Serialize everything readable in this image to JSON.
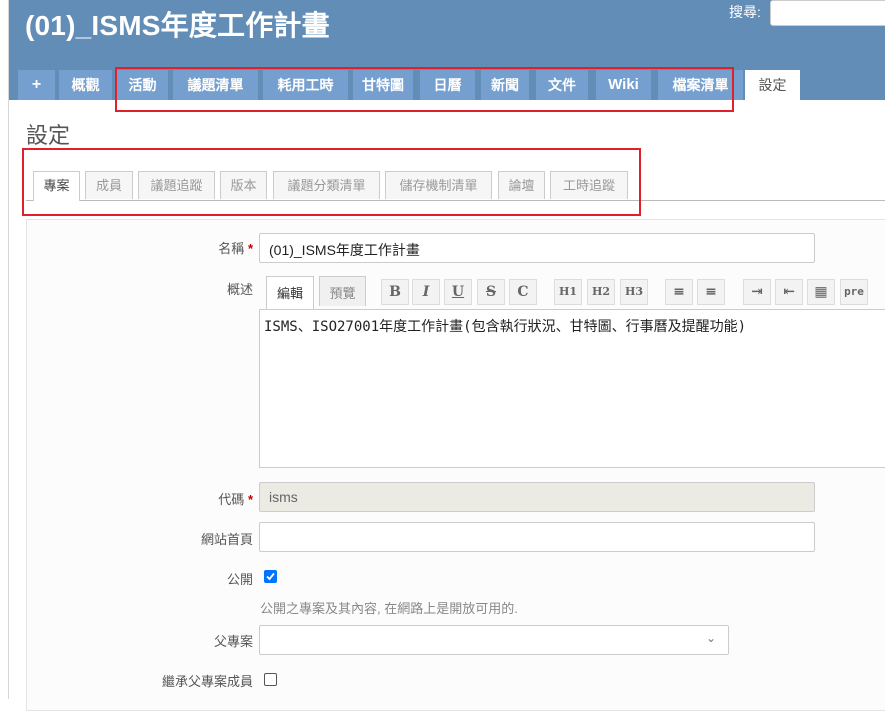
{
  "header": {
    "title": "(01)_ISMS年度工作計畫",
    "search_label": "搜尋:"
  },
  "menu": {
    "plus": "+",
    "items": [
      "概觀",
      "活動",
      "議題清單",
      "耗用工時",
      "甘特圖",
      "日曆",
      "新聞",
      "文件",
      "Wiki",
      "檔案清單",
      "設定"
    ]
  },
  "page_title": "設定",
  "subtabs": [
    "專案",
    "成員",
    "議題追蹤",
    "版本",
    "議題分類清單",
    "儲存機制清單",
    "論壇",
    "工時追蹤"
  ],
  "form": {
    "name_label": "名稱",
    "name_value": "(01)_ISMS年度工作計畫",
    "required_mark": "*",
    "desc_label": "概述",
    "edit_tab": "編輯",
    "preview_tab": "預覽",
    "toolbar": [
      "B",
      "I",
      "U",
      "S",
      "C",
      "H1",
      "H2",
      "H3",
      "≡",
      "≡",
      "⇥",
      "⇤",
      "▦",
      "pre"
    ],
    "desc_value": "ISMS、ISO27001年度工作計畫(包含執行狀況、甘特圖、行事曆及提醒功能)",
    "identifier_label": "代碼",
    "identifier_value": "isms",
    "homepage_label": "網站首頁",
    "homepage_value": "",
    "public_label": "公開",
    "public_hint": "公開之專案及其內容, 在網路上是開放可用的.",
    "parent_label": "父專案",
    "inherit_label": "繼承父專案成員"
  },
  "colors": {
    "header": "#628db6",
    "tab": "#759fcf",
    "highlight": "#e0202a",
    "required": "#bb0000"
  }
}
